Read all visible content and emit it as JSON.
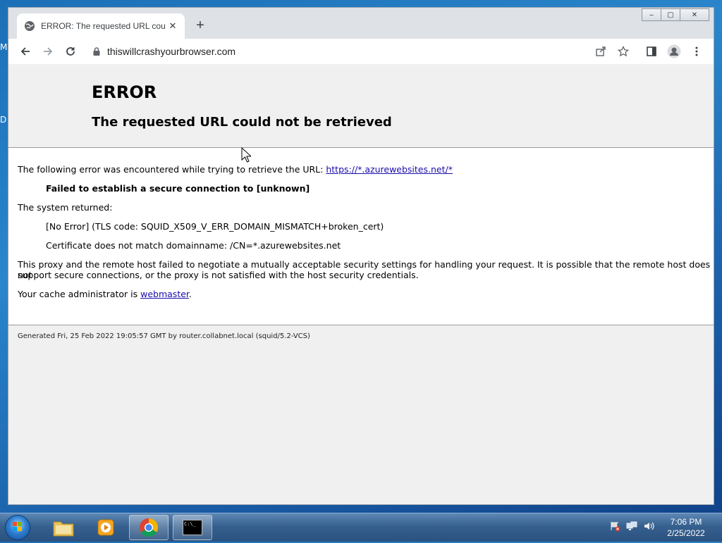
{
  "desktop": {
    "label_m": "M",
    "label_d": "D"
  },
  "window": {
    "controls": {
      "minimize": "‒",
      "maximize": "▢",
      "close": "✕"
    },
    "tab": {
      "title": "ERROR: The requested URL could not be retrieved",
      "close": "✕"
    },
    "new_tab": "+",
    "address": "thiswillcrashyourbrowser.com"
  },
  "page": {
    "heading": "ERROR",
    "subheading": "The requested URL could not be retrieved",
    "intro_text": "The following error was encountered while trying to retrieve the URL: ",
    "intro_link": "https://*.azurewebsites.net/*",
    "failure": "Failed to establish a secure connection to [unknown]",
    "system_returned": "The system returned:",
    "tls_error": "[No Error] (TLS code: SQUID_X509_V_ERR_DOMAIN_MISMATCH+broken_cert)",
    "cert_mismatch": "Certificate does not match domainname: /CN=*.azurewebsites.net",
    "explanation_line1": "This proxy and the remote host failed to negotiate a mutually acceptable security settings for handling your request. It is possible that the remote host does not",
    "explanation_line2": "support secure connections, or the proxy is not satisfied with the host security credentials.",
    "admin_text": "Your cache administrator is ",
    "admin_link": "webmaster",
    "admin_suffix": ".",
    "footer": "Generated Fri, 25 Feb 2022 19:05:57 GMT by router.collabnet.local (squid/5.2-VCS)"
  },
  "taskbar": {
    "apps": [
      "windows-explorer",
      "media-player",
      "google-chrome",
      "command-prompt"
    ],
    "cmd_glyph": "C:\\_",
    "clock_time": "7:06 PM",
    "clock_date": "2/25/2022"
  },
  "colors": {
    "link": "#1a0dab",
    "page_bg": "#f0f0f0",
    "content_bg": "#ffffff",
    "desktop": "#1f74bb"
  }
}
